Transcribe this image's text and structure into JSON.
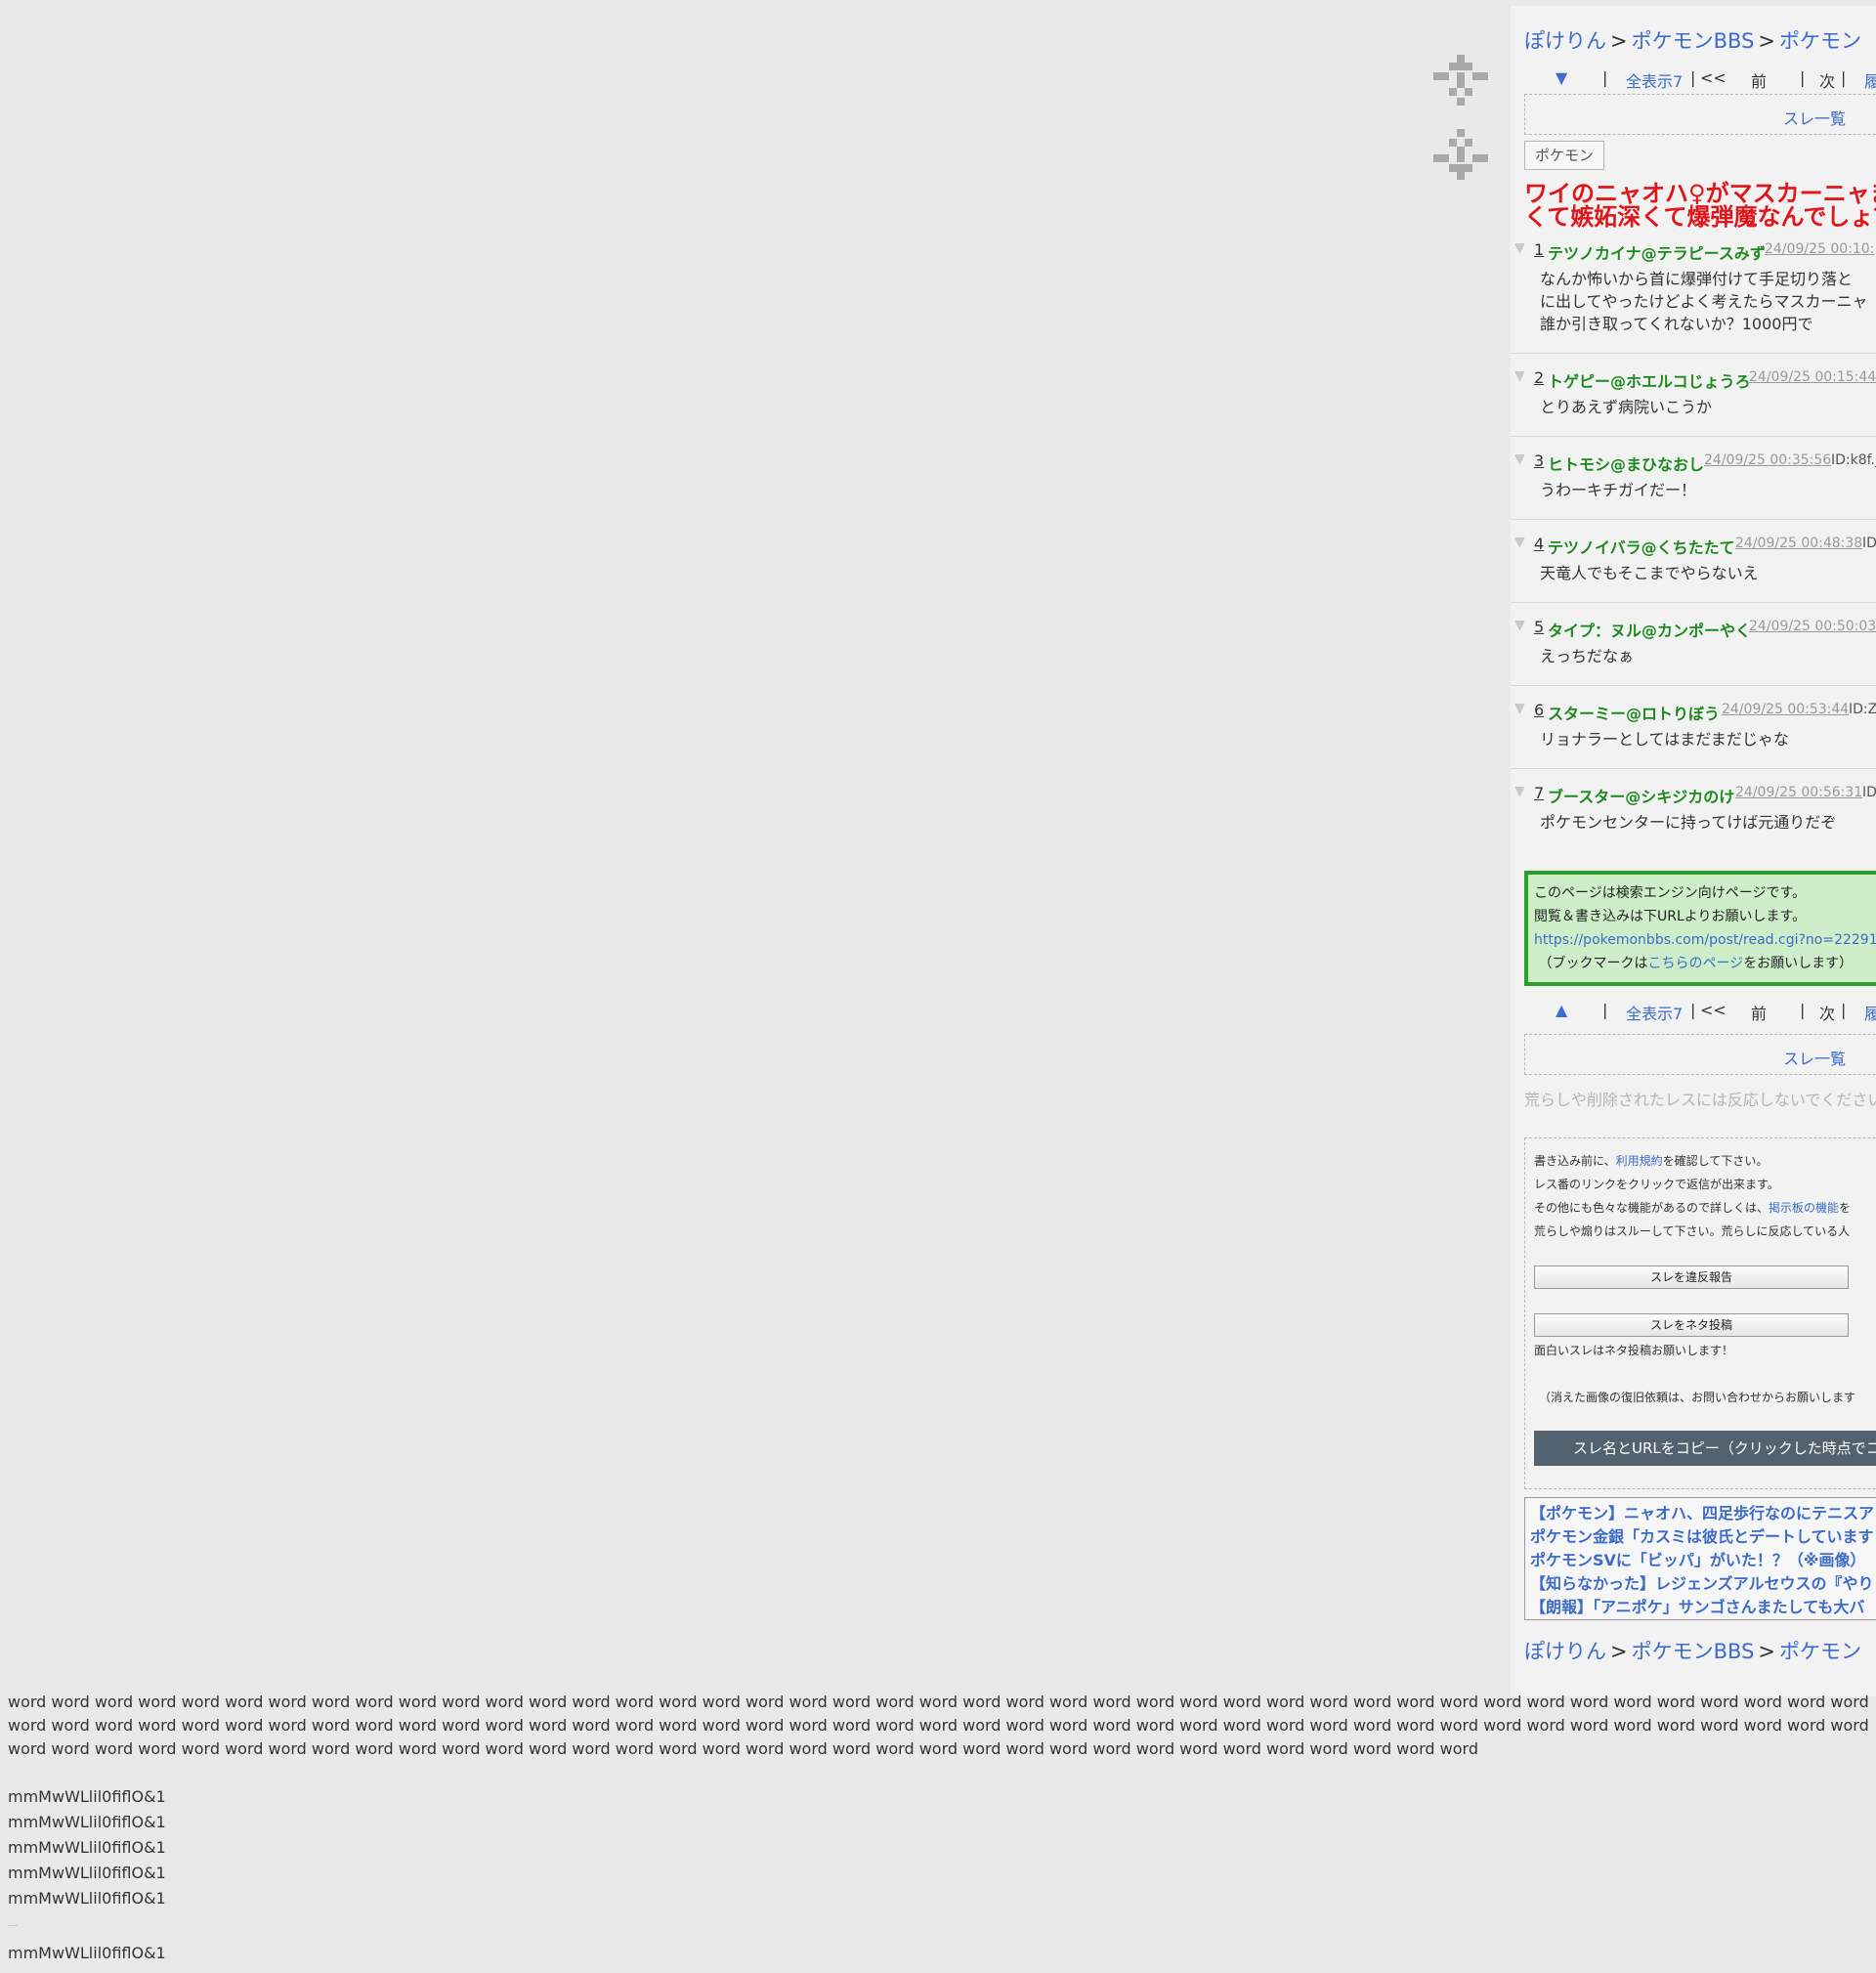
{
  "breadcrumb": {
    "home": "ぽけりん",
    "board": "ポケモンBBS",
    "category": "ポケモン",
    "separator": ">"
  },
  "nav": {
    "down_arrow": "▼",
    "up_arrow": "▲",
    "bar1": "|",
    "show_all": "全表示7",
    "bar2": "|",
    "first": "<<",
    "prev": "前",
    "bar3": "|",
    "next": "次",
    "bar4": "|",
    "history": "履"
  },
  "thread_list_label": "スレ一覧",
  "category_tag": "ポケモン",
  "thread_title": {
    "line1": "ワイのニャオハ♀がマスカーニャま",
    "line2": "くて嫉妬深くて爆弾魔なんでしょ？"
  },
  "posts": [
    {
      "no": "1",
      "name": "テツノカイナ@テラピースみず",
      "date": "24/09/25 00:10:",
      "id": "",
      "lines": [
        "なんか怖いから首に爆弾付けて手足切り落と",
        "に出してやったけどよく考えたらマスカーニャ",
        "誰か引き取ってくれないか？1000円で"
      ]
    },
    {
      "no": "2",
      "name": "トゲピー@ホエルコじょうろ",
      "date": "24/09/25 00:15:44",
      "id": "",
      "lines": [
        "とりあえず病院いこうか"
      ]
    },
    {
      "no": "3",
      "name": "ヒトモシ@まひなおし",
      "date": "24/09/25 00:35:56",
      "id": "ID:k8f.j",
      "lines": [
        "うわーキチガイだー！"
      ]
    },
    {
      "no": "4",
      "name": "テツノイバラ@くちたたて",
      "date": "24/09/25 00:48:38",
      "id": "ID",
      "lines": [
        "天竜人でもそこまでやらないえ"
      ]
    },
    {
      "no": "5",
      "name": "タイプ：ヌル@カンポーやく",
      "date": "24/09/25 00:50:03",
      "id": "",
      "lines": [
        "えっちだなぁ"
      ]
    },
    {
      "no": "6",
      "name": "スターミー@ロトりぼう",
      "date": "24/09/25 00:53:44",
      "id": "ID:Zl",
      "lines": [
        "リョナラーとしてはまだまだじゃな"
      ]
    },
    {
      "no": "7",
      "name": "ブースター@シキジカのけ",
      "date": "24/09/25 00:56:31",
      "id": "ID",
      "lines": [
        "ポケモンセンターに持ってけば元通りだぞ"
      ]
    }
  ],
  "notice": {
    "line1": "このページは検索エンジン向けページです。",
    "line2": "閲覧＆書き込みは下URLよりお願いします。",
    "url": "https://pokemonbbs.com/post/read.cgi?no=22291",
    "line4_pre": "（ブックマークは",
    "line4_link": "こちらのページ",
    "line4_post": "をお願いします）"
  },
  "warn_muted": "荒らしや削除されたレスには反応しないでください",
  "rules": {
    "l1_pre": "書き込み前に、",
    "l1_link": "利用規約",
    "l1_post": "を確認して下さい。",
    "l2": "レス番のリンクをクリックで返信が出来ます。",
    "l3_pre": "その他にも色々な機能があるので詳しくは、",
    "l3_link": "掲示板の機能",
    "l3_post": "を",
    "l4": "荒らしや煽りはスルーして下さい。荒らしに反応している人",
    "report_button": "スレを違反報告",
    "neta_button": "スレをネタ投稿",
    "neta_note": "面白いスレはネタ投稿お願いします！",
    "restore_note": "（消えた画像の復旧依頼は、お問い合わせからお願いします",
    "copy_button": "スレ名とURLをコピー（クリックした時点でコ"
  },
  "related": [
    "【ポケモン】ニャオハ、四足歩行なのにテニスア",
    "ポケモン金銀「カスミは彼氏とデートしています",
    "ポケモンSVに「ビッパ」がいた！？（※画像）",
    "【知らなかった】レジェンズアルセウスの『やり",
    "【朗報】「アニポケ」サンゴさんまたしても大バ"
  ],
  "filler_text": "word word word word word word word word word word word word word word word word word word word word word word word word word word word word word word word word word word word word word word word word word word word word word word word word word word word word word word word word word word word word word word word word word word word word word word word word word word word word word word word word word word word word word word word word word word word word word word word word word word word word word word word word word word word word word word word word word word word word word word word word",
  "samples": [
    "mmMwWLlil0fiflO&1",
    "mmMwWLlil0fiflO&1",
    "mmMwWLlil0fiflO&1",
    "mmMwWLlil0fiflO&1",
    "mmMwWLlil0fiflO&1"
  ],
  "sample_last": "mmMwWLlil0fiflO&1",
  "sample_dash": "—"
}
